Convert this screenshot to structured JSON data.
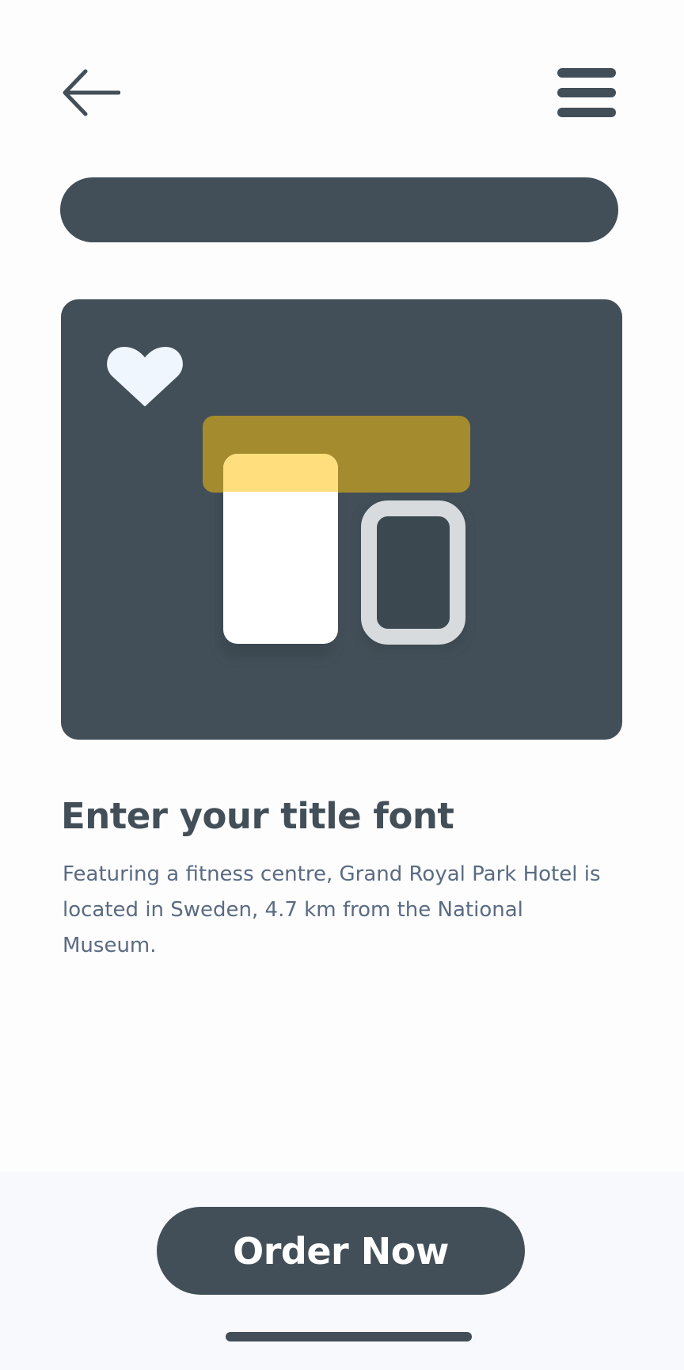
{
  "colors": {
    "primary": "#434f58",
    "accent_gold": "#a38b2e",
    "accent_yellow": "#ffdf7d",
    "heart": "#eff6fd",
    "text_secondary": "#5a6b82",
    "background": "#fdfdfe",
    "footer_background": "#f7f9fc"
  },
  "header": {
    "back_icon": "arrow-left-icon",
    "menu_icon": "hamburger-menu-icon"
  },
  "hero": {
    "favorite_icon": "heart-icon",
    "illustration": "product-boxes-illustration"
  },
  "content": {
    "title": "Enter your title font",
    "description": "Featuring a fitness centre, Grand Royal Park Hotel is located in Sweden, 4.7 km from the National Museum."
  },
  "footer": {
    "order_label": "Order Now"
  }
}
